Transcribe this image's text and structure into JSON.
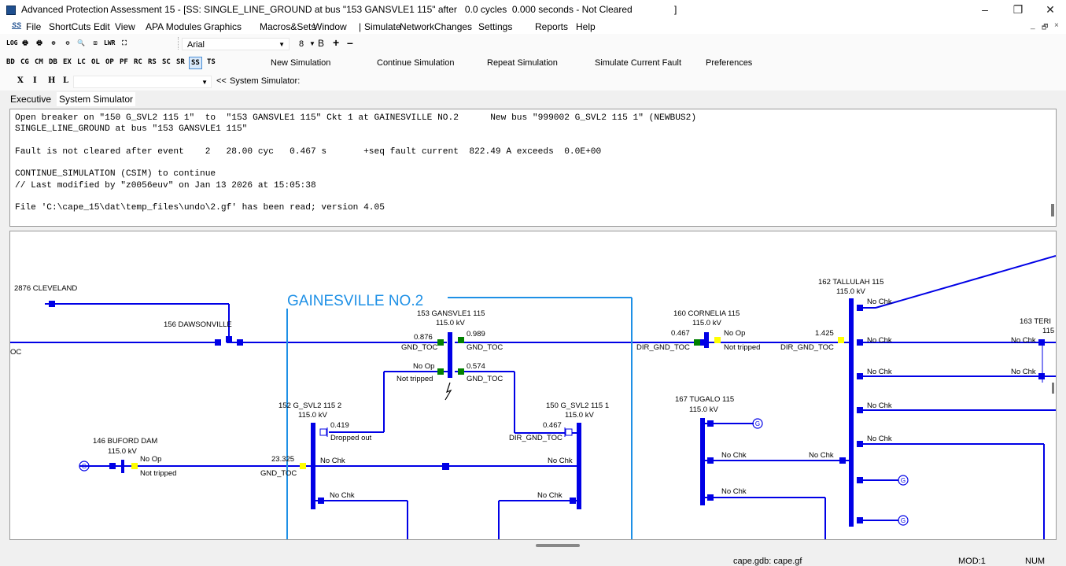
{
  "window": {
    "title": "Advanced Protection Assessment 15 - [SS: SINGLE_LINE_GROUND at bus \"153 GANSVLE1 115\" after   0.0 cycles  0.000 seconds - Not Cleared                ]",
    "minimize": "–",
    "restore": "❐",
    "close": "✕"
  },
  "menu": {
    "items": [
      "File",
      "ShortCuts",
      "Edit",
      "View",
      "APA Modules",
      "Graphics",
      "Macros&Sets",
      "Window",
      "|",
      "Simulate",
      "NetworkChanges",
      "Settings",
      "Reports",
      "Help"
    ],
    "mdi_min": "_",
    "mdi_restore": "🗗",
    "mdi_close": "×"
  },
  "toolbar1": {
    "icons": [
      "LOG",
      "🖶",
      "🖶",
      "⊕",
      "⊖",
      "🔍",
      "⊡",
      "LWR",
      "⛶"
    ],
    "icon_names": [
      "log-icon",
      "print-icon",
      "print-preview-icon",
      "zoom-in-icon",
      "zoom-out-icon",
      "zoom-fit-icon",
      "zoom-window-icon",
      "lwr-icon",
      "pan-icon"
    ],
    "font_name": "Arial",
    "font_size": "8",
    "bold": "B",
    "plus": "+",
    "minus": "–"
  },
  "toolbar2": {
    "mnemonics": [
      "BD",
      "CG",
      "CM",
      "DB",
      "EX",
      "LC",
      "OL",
      "OP",
      "PF",
      "RC",
      "RS",
      "SC",
      "SR",
      "SS",
      "TS"
    ],
    "selected": "SS",
    "sim_buttons": [
      "New Simulation",
      "Continue Simulation",
      "Repeat Simulation",
      "Simulate Current Fault",
      "Preferences"
    ]
  },
  "toolbar3": {
    "letters": [
      "X",
      "I",
      "H",
      "L"
    ],
    "back": "<<",
    "label": "System Simulator:"
  },
  "tabs": [
    "Executive",
    "System Simulator"
  ],
  "console": {
    "lines": [
      "Open breaker on \"150 G_SVL2 115 1\"  to  \"153 GANSVLE1 115\" Ckt 1 at GAINESVILLE NO.2      New bus \"999002 G_SVL2 115 1\" (NEWBUS2)",
      "SINGLE_LINE_GROUND at bus \"153 GANSVLE1 115\"",
      "",
      "Fault is not cleared after event    2   28.00 cyc   0.467 s       +seq fault current  822.49 A exceeds  0.0E+00",
      "",
      "CONTINUE_SIMULATION (CSIM) to continue",
      "// Last modified by \"z0056euv\" on Jan 13 2026 at 15:05:38",
      "",
      "File 'C:\\cape_15\\dat\\temp_files\\undo\\2.gf' has been read; version 4.05"
    ]
  },
  "diagram": {
    "station_label": "GAINESVILLE NO.2",
    "buses": {
      "cleveland": "2876 CLEVELAND",
      "dawsonville": "156 DAWSONVILLE",
      "gansvle1": "153 GANSVLE1 115",
      "gansvle1_kv": "115.0 kV",
      "cornelia": "160 CORNELIA 115",
      "cornelia_kv": "115.0 kV",
      "tallulah": "162 TALLULAH 115",
      "tallulah_kv": "115.0 kV",
      "teri": "163 TERI",
      "teri_kv": "115",
      "gsvl2_2": "152 G_SVL2 115 2",
      "gsvl2_2_kv": "115.0 kV",
      "gsvl2_1": "150 G_SVL2 115 1",
      "gsvl2_1_kv": "115.0 kV",
      "buford": "146 BUFORD DAM",
      "buford_kv": "115.0 kV",
      "tugalo": "167 TUGALO 115",
      "tugalo_kv": "115.0 kV"
    },
    "labels": {
      "oc": "OC",
      "v0876": "0.876",
      "gnd_toc_a": "GND_TOC",
      "v0989": "0.989",
      "gnd_toc_b": "GND_TOC",
      "noop_a": "No Op",
      "nottripped_a": "Not tripped",
      "v0574": "0.574",
      "gnd_toc_c": "GND_TOC",
      "v0467_c": "0.467",
      "dir_gnd_toc_c": "DIR_GND_TOC",
      "noop_c": "No Op",
      "nottripped_c": "Not tripped",
      "v1425": "1.425",
      "dir_gnd_toc_d": "DIR_GND_TOC",
      "nochk_t1": "No Chk",
      "nochk_t2": "No Chk",
      "nochk_t3": "No Chk",
      "nochk_t4": "No Chk",
      "nochk_t5": "No Chk",
      "nochk_r1": "No Chk",
      "nochk_r2": "No Chk",
      "v0419": "0.419",
      "dropped_out": "Dropped out",
      "v0467_b": "0.467",
      "dir_gnd_toc_b": "DIR_GND_TOC",
      "noop_bf": "No Op",
      "nottripped_bf": "Not tripped",
      "v23325": "23.325",
      "gnd_toc_bf": "GND_TOC",
      "nochk_b1": "No Chk",
      "nochk_b2": "No Chk",
      "nochk_b3": "No Chk",
      "nochk_b4": "No Chk",
      "nochk_tg1": "No Chk",
      "nochk_tg2": "No Chk",
      "nochk_tg3": "No Chk",
      "gen": "G"
    }
  },
  "status": {
    "db": "cape.gdb: cape.gf",
    "mod": "MOD:1",
    "num": "NUM"
  },
  "colors": {
    "line": "#0000e6",
    "station_box": "#1e90e6",
    "breaker_open": "#ffff00",
    "breaker_closed": "#008000",
    "selected_tab": "#ffffff"
  }
}
